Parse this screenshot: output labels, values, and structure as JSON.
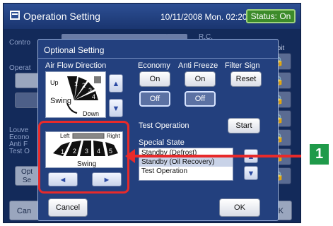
{
  "window": {
    "title": "Operation Setting",
    "datetime": "10/11/2008 Mon. 02:20 PM",
    "status": "Status:  On"
  },
  "background": {
    "control_label": "Contro",
    "operat_label": "Operat",
    "rc_label": "R.C.",
    "prohibit_label": "rohibit",
    "louver_lines": [
      "Louve",
      "Econo",
      "Anti F",
      "Test O"
    ],
    "opt_btn_lines": [
      "Opt",
      "Se"
    ],
    "cancel_partial": "Can",
    "ok_partial": "OK",
    "lock_glyph": "🔒"
  },
  "dialog": {
    "title": "Optional Setting",
    "air_flow": {
      "label": "Air Flow Direction",
      "up": "Up",
      "down": "Down",
      "swing": "Swing",
      "positions": [
        "1",
        "2",
        "3",
        "4"
      ]
    },
    "economy": {
      "label": "Economy",
      "on": "On",
      "off": "Off"
    },
    "anti_freeze": {
      "label": "Anti Freeze",
      "on": "On",
      "off": "Off"
    },
    "filter_sign": {
      "label": "Filter Sign",
      "reset": "Reset"
    },
    "test_operation": {
      "label": "Test Operation",
      "start": "Start"
    },
    "special_state": {
      "label": "Special State",
      "items": [
        "Standby (Defrost)",
        "Standby (Oil Recovery)",
        "Test Operation"
      ]
    },
    "louver": {
      "left": "Left",
      "right": "Right",
      "swing": "Swing",
      "positions": [
        "1",
        "2",
        "3",
        "4",
        "5"
      ]
    },
    "cancel": "Cancel",
    "ok": "OK"
  },
  "callout": {
    "number": "1"
  },
  "colors": {
    "highlight": "#e82a2a",
    "badge": "#1f9a4a",
    "status": "#3c8b2a"
  }
}
